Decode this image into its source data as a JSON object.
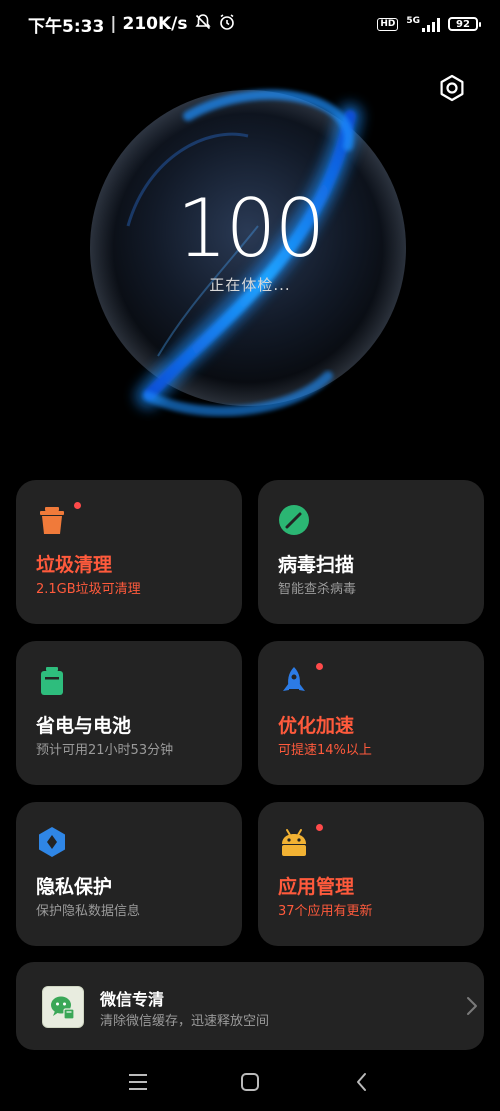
{
  "status_bar": {
    "time": "下午5:33",
    "separator": "|",
    "net_speed": "210K/s",
    "hd_badge": "HD",
    "network": "5G",
    "battery": "92"
  },
  "orb": {
    "score": "100",
    "status": "正在体检..."
  },
  "cards": [
    {
      "title": "垃圾清理",
      "subtitle": "2.1GB垃圾可清理",
      "icon": "trash-can-icon",
      "highlight": true,
      "badge": true
    },
    {
      "title": "病毒扫描",
      "subtitle": "智能查杀病毒",
      "icon": "radar-scan-icon",
      "highlight": false,
      "badge": false
    },
    {
      "title": "省电与电池",
      "subtitle": "预计可用21小时53分钟",
      "icon": "battery-icon",
      "highlight": false,
      "badge": false
    },
    {
      "title": "优化加速",
      "subtitle": "可提速14%以上",
      "icon": "rocket-icon",
      "highlight": true,
      "badge": true
    },
    {
      "title": "隐私保护",
      "subtitle": "保护隐私数据信息",
      "icon": "privacy-shield-icon",
      "highlight": false,
      "badge": false
    },
    {
      "title": "应用管理",
      "subtitle": "37个应用有更新",
      "icon": "android-app-icon",
      "highlight": true,
      "badge": true
    }
  ],
  "wechat": {
    "title": "微信专清",
    "subtitle": "清除微信缓存，迅速释放空间",
    "icon": "wechat-clean-icon"
  },
  "nav": {
    "menu_icon": "menu-icon",
    "home_icon": "home-square-icon",
    "back_icon": "back-icon"
  },
  "colors": {
    "background": "#000000",
    "card": "#232323",
    "accent_red": "#ff5a3c",
    "badge_red": "#ff4a4a",
    "trash_orange": "#f07a3a",
    "scan_green": "#2bb673",
    "battery_green": "#2ebd7d",
    "rocket_blue": "#2c7be5",
    "shield_blue": "#2f86e6",
    "android_yellow": "#f2b233",
    "orb_blue": "#1e90ff"
  }
}
